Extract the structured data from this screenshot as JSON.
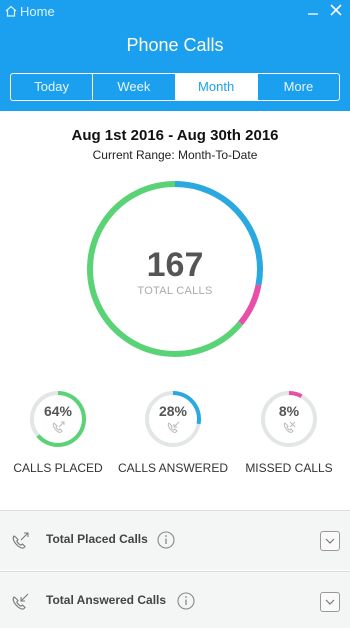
{
  "window": {
    "title": "Home"
  },
  "header": {
    "title": "Phone Calls",
    "tabs": [
      {
        "label": "Today",
        "active": false
      },
      {
        "label": "Week",
        "active": false
      },
      {
        "label": "Month",
        "active": true
      },
      {
        "label": "More",
        "active": false
      }
    ]
  },
  "summary": {
    "date_range": "Aug 1st 2016 - Aug 30th 2016",
    "current_range": "Current Range: Month-To-Date",
    "total_calls": "167",
    "total_label": "TOTAL CALLS"
  },
  "breakdown": [
    {
      "name": "placed",
      "percent_text": "64%",
      "label": "CALLS PLACED",
      "fraction": 0.64,
      "color": "#5ad376"
    },
    {
      "name": "answered",
      "percent_text": "28%",
      "label": "CALLS ANSWERED",
      "fraction": 0.28,
      "color": "#29a9e0"
    },
    {
      "name": "missed",
      "percent_text": "8%",
      "label": "MISSED CALLS",
      "fraction": 0.08,
      "color": "#e84fa8"
    }
  ],
  "rows": [
    {
      "label": "Total Placed Calls",
      "icon": "outgoing-call-icon"
    },
    {
      "label": "Total Answered Calls",
      "icon": "incoming-call-icon"
    }
  ],
  "colors": {
    "header": "#1aa0ee",
    "placed": "#5ad376",
    "answered": "#29a9e0",
    "missed": "#e84fa8",
    "track": "#e3e6e6"
  }
}
